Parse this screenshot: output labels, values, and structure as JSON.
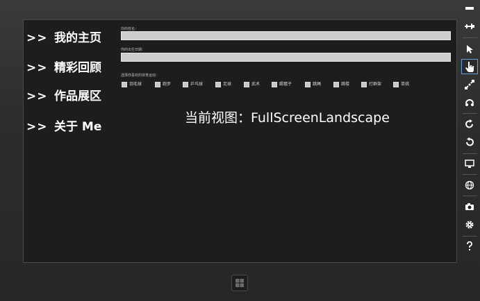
{
  "app": {
    "nav": [
      {
        "arrow": ">>",
        "label": "我的主页"
      },
      {
        "arrow": ">>",
        "label": "精彩回顾"
      },
      {
        "arrow": ">>",
        "label": "作品展区"
      },
      {
        "arrow": ">>",
        "label": "关于 Me"
      }
    ],
    "form": {
      "name_label": "你的姓名：",
      "name_value": "",
      "birthday_label": "你的出生日期：",
      "birthday_value": "",
      "sports_label": "选择你喜欢的体育运动：",
      "sports": [
        "羽毛球",
        "跑步",
        "乒乓球",
        "足球",
        "武术",
        "踢毽子",
        "跳绳",
        "跳楼",
        "打群架",
        "单挑"
      ]
    },
    "view_state_text": "当前视图：FullScreenLandscape"
  },
  "simulator_toolbar": {
    "buttons": [
      "minimize-icon",
      "pin-icon",
      "mouse-pointer-icon",
      "touch-hand-icon",
      "pinch-zoom-icon",
      "rotate-touch-icon",
      "rotate-clockwise-icon",
      "rotate-counterclockwise-icon",
      "resolution-monitor-icon",
      "location-globe-icon",
      "screenshot-camera-icon",
      "settings-gear-icon",
      "help-icon"
    ],
    "active": "touch-hand-icon"
  },
  "colors": {
    "accent": "#6aa0d8",
    "screen_bg": "#1d1d1d",
    "bezel": "#2d2d2d"
  }
}
